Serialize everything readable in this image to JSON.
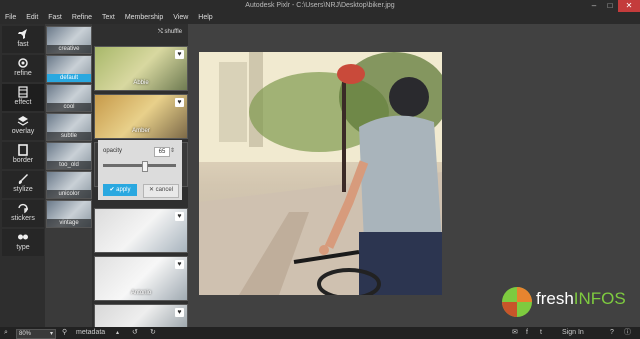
{
  "window": {
    "title": "Autodesk Pixlr - C:\\Users\\NRJ\\Desktop\\biker.jpg"
  },
  "menu": [
    "File",
    "Edit",
    "Fast",
    "Refine",
    "Text",
    "Membership",
    "View",
    "Help"
  ],
  "tools": [
    {
      "label": "fast",
      "icon": "rocket-icon"
    },
    {
      "label": "refine",
      "icon": "refine-icon"
    },
    {
      "label": "effect",
      "icon": "film-icon"
    },
    {
      "label": "overlay",
      "icon": "layers-icon"
    },
    {
      "label": "border",
      "icon": "border-icon"
    },
    {
      "label": "stylize",
      "icon": "brush-icon"
    },
    {
      "label": "stickers",
      "icon": "sticker-icon"
    },
    {
      "label": "type",
      "icon": "quote-icon"
    }
  ],
  "categories": [
    "creative",
    "default",
    "cool",
    "subtle",
    "too_old",
    "unicolor",
    "vintage"
  ],
  "shuffle_label": "shuffle",
  "effects": [
    "Abbie",
    "Amber",
    "",
    "",
    "",
    "Antonio",
    ""
  ],
  "popup": {
    "opacity_label": "opacity",
    "opacity_value": "65",
    "apply": "apply",
    "cancel": "cancel"
  },
  "status": {
    "zoom": "80%",
    "metadata": "metadata",
    "signin": "Sign In"
  },
  "watermark": {
    "prefix": "fresh",
    "suffix": "INFOS"
  },
  "colors": {
    "accent": "#2aa8e0",
    "watermark_green": "#7ecb3f"
  }
}
